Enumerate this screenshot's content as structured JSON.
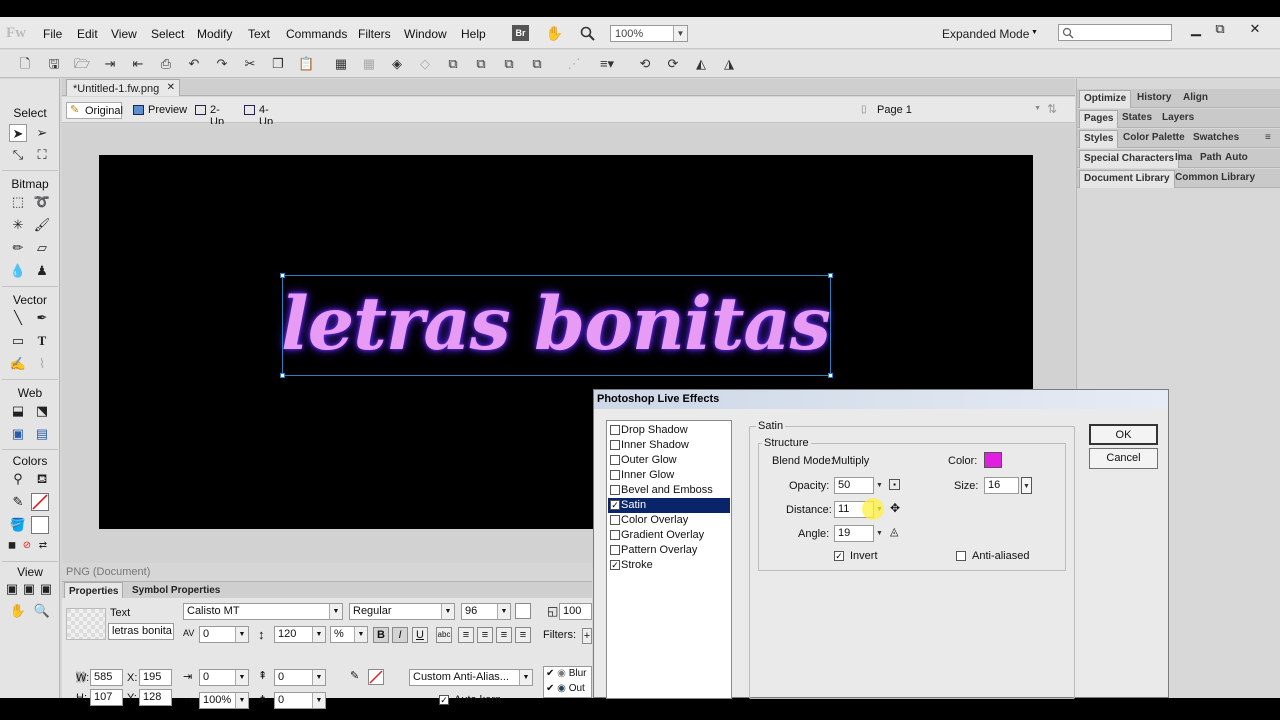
{
  "menubar": {
    "logo": "Fw",
    "items": [
      "File",
      "Edit",
      "View",
      "Select",
      "Modify",
      "Text",
      "Commands",
      "Filters",
      "Window",
      "Help"
    ],
    "bridge": "Br",
    "zoom": "100%",
    "mode": "Expanded Mode"
  },
  "document": {
    "tab_title": "*Untitled-1.fw.png",
    "views": [
      "Original",
      "Preview",
      "2-Up",
      "4-Up"
    ],
    "page": "Page 1",
    "status": "PNG (Document)"
  },
  "canvas": {
    "text": "letras bonitas",
    "colors": {
      "bg": "#000000",
      "text": "#e89bf4",
      "glow": "#4a1cc9"
    }
  },
  "tools": {
    "sections": [
      "Select",
      "Bitmap",
      "Vector",
      "Web",
      "Colors",
      "View"
    ]
  },
  "properties": {
    "tabs": [
      "Properties",
      "Symbol Properties"
    ],
    "type": "Text",
    "name": "letras bonita",
    "font": "Calisto MT",
    "style": "Regular",
    "size": "96",
    "opacity": "100",
    "kerning": "0",
    "leading": "120",
    "leading_unit": "%",
    "bold": "B",
    "italic": "I",
    "underline": "U",
    "indent": "0",
    "space_before": "0",
    "space_after": "0",
    "scale": "100%",
    "baseline": "0",
    "antialias": "Custom Anti-Alias...",
    "auto_kern": "Auto kern",
    "w_label": "W:",
    "w": "585",
    "x_label": "X:",
    "x": "195",
    "h_label": "H:",
    "h": "107",
    "y_label": "Y:",
    "y": "128",
    "filters_label": "Filters:",
    "filter_items": [
      "Blur",
      "Out"
    ]
  },
  "panels": {
    "row1": [
      "Optimize",
      "History",
      "Align"
    ],
    "row2": [
      "Pages",
      "States",
      "Layers"
    ],
    "row3": [
      "Styles",
      "Color Palette",
      "Swatches"
    ],
    "row4": [
      "Special Characters",
      "Ima",
      "Path",
      "Auto"
    ],
    "row5": [
      "Document Library",
      "Common Library"
    ]
  },
  "dialog": {
    "title": "Photoshop Live Effects",
    "effects": [
      {
        "label": "Drop Shadow",
        "checked": false
      },
      {
        "label": "Inner Shadow",
        "checked": false
      },
      {
        "label": "Outer Glow",
        "checked": false
      },
      {
        "label": "Inner Glow",
        "checked": false
      },
      {
        "label": "Bevel and Emboss",
        "checked": false
      },
      {
        "label": "Satin",
        "checked": true
      },
      {
        "label": "Color Overlay",
        "checked": false
      },
      {
        "label": "Gradient Overlay",
        "checked": false
      },
      {
        "label": "Pattern Overlay",
        "checked": false
      },
      {
        "label": "Stroke",
        "checked": true
      }
    ],
    "section": "Satin",
    "group": "Structure",
    "blend_mode_label": "Blend Mode:",
    "blend_mode": "Multiply",
    "color_label": "Color:",
    "color": "#e01fe0",
    "opacity_label": "Opacity:",
    "opacity": "50",
    "size_label": "Size:",
    "size": "16",
    "distance_label": "Distance:",
    "distance": "11",
    "angle_label": "Angle:",
    "angle": "19",
    "invert_label": "Invert",
    "antialiased_label": "Anti-aliased",
    "ok": "OK",
    "cancel": "Cancel"
  }
}
